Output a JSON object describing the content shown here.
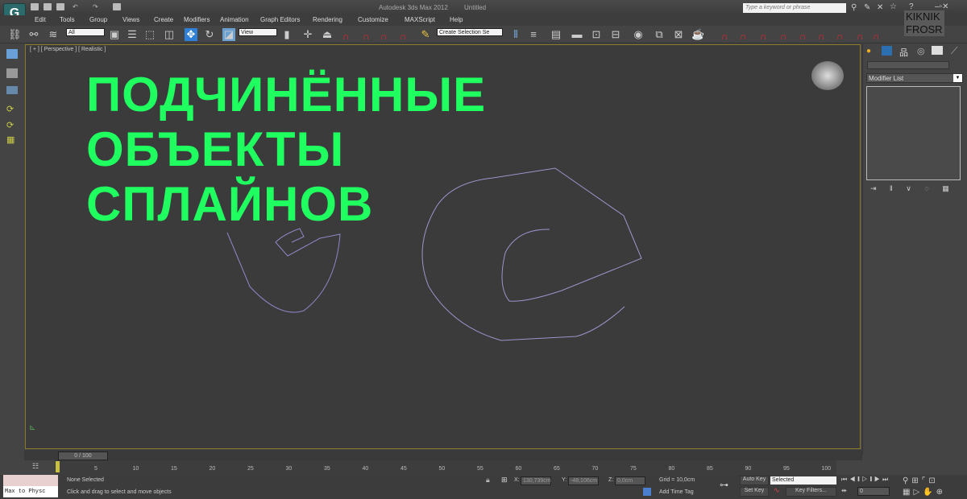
{
  "app": {
    "title": "Autodesk 3ds Max 2012",
    "document": "Untitled",
    "logo": "G"
  },
  "search": {
    "placeholder": "Type a keyword or phrase"
  },
  "menu": [
    "Edit",
    "Tools",
    "Group",
    "Views",
    "Create",
    "Modifiers",
    "Animation",
    "Graph Editors",
    "Rendering",
    "Customize",
    "MAXScript",
    "Help"
  ],
  "toolbar": {
    "selection_filter": "All",
    "reference_coord": "View",
    "named_selection": "Create Selection Se"
  },
  "watermark": [
    "KIKNIK",
    "FROSR"
  ],
  "viewport": {
    "label": "[ + ] [ Perspective ] [ Realistic ]",
    "overlay_lines": [
      "ПОДЧИНЁННЫЕ",
      "ОБЪЕКТЫ",
      "СПЛАЙНОВ"
    ]
  },
  "command_panel": {
    "modifier_list": "Modifier List"
  },
  "timeline": {
    "frame": "0 / 100",
    "ticks": [
      "5",
      "10",
      "15",
      "20",
      "25",
      "30",
      "35",
      "40",
      "45",
      "50",
      "55",
      "60",
      "65",
      "70",
      "75",
      "80",
      "85",
      "90",
      "95",
      "100"
    ]
  },
  "status": {
    "selection": "None Selected",
    "prompt": "Click and drag to select and move objects",
    "maxscript": "Max to Physc",
    "x_label": "X:",
    "x": "130,739cm",
    "y_label": "Y:",
    "y": "-48,106cm",
    "z_label": "Z:",
    "z": "0,0cm",
    "grid": "Grid = 10,0cm",
    "add_time_tag": "Add Time Tag",
    "auto_key": "Auto Key",
    "auto_key_mode": "Selected",
    "set_key": "Set Key",
    "key_filters": "Key Filters...",
    "current_frame": "0"
  },
  "colors": {
    "overlay_text": "#1fff5f",
    "spline": "#8d88c8",
    "viewport_bg": "#3b3b3b"
  }
}
